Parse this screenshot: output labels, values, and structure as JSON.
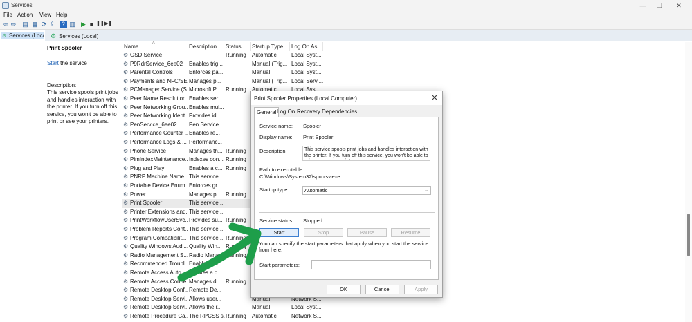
{
  "window": {
    "title": "Services",
    "min_glyph": "—",
    "max_glyph": "❐",
    "close_glyph": "✕"
  },
  "menu": [
    "File",
    "Action",
    "View",
    "Help"
  ],
  "toolbar": {
    "icons": [
      "back-icon",
      "forward-icon",
      "console-tree-icon",
      "properties-icon",
      "refresh-icon",
      "export-icon",
      "help-icon",
      "view-icon",
      "start-service-icon",
      "stop-service-icon",
      "pause-service-icon",
      "restart-service-icon"
    ],
    "glyphs": [
      "⇦",
      "⇨",
      "▤",
      "▦",
      "⟳",
      "⇪",
      "?",
      "▥",
      "▶",
      "■",
      "❚❚",
      "▶❚"
    ]
  },
  "tree": {
    "node": "Services (Loca"
  },
  "header": {
    "title": "Services (Local)"
  },
  "detail": {
    "service_name": "Print Spooler",
    "start_link": "Start",
    "start_suffix": " the service",
    "description_label": "Description:",
    "description": "This service spools print jobs and handles interaction with the printer.  If you turn off this service, you won't be able to print or see your printers."
  },
  "columns": {
    "name": "Name",
    "description": "Description",
    "status": "Status",
    "startup_type": "Startup Type",
    "log_on_as": "Log On As",
    "sort_glyph": "^"
  },
  "services": [
    {
      "name": "OSD Service",
      "desc": "",
      "status": "Running",
      "stype": "Automatic",
      "logon": "Local Syst..."
    },
    {
      "name": "P9RdrService_6ee02",
      "desc": "Enables trig...",
      "status": "",
      "stype": "Manual (Trig...",
      "logon": "Local Syst..."
    },
    {
      "name": "Parental Controls",
      "desc": "Enforces pa...",
      "status": "",
      "stype": "Manual",
      "logon": "Local Syst..."
    },
    {
      "name": "Payments and NFC/SE...",
      "desc": "Manages p...",
      "status": "",
      "stype": "Manual (Trig...",
      "logon": "Local Servi..."
    },
    {
      "name": "PCManager Service (S...",
      "desc": "Microsoft P...",
      "status": "Running",
      "stype": "Automatic",
      "logon": "Local Syst..."
    },
    {
      "name": "Peer Name Resolution...",
      "desc": "Enables ser...",
      "status": "",
      "stype": "",
      "logon": ""
    },
    {
      "name": "Peer Networking Grou...",
      "desc": "Enables mul...",
      "status": "",
      "stype": "",
      "logon": ""
    },
    {
      "name": "Peer Networking Ident...",
      "desc": "Provides id...",
      "status": "",
      "stype": "",
      "logon": ""
    },
    {
      "name": "PenService_6ee02",
      "desc": "Pen Service",
      "status": "",
      "stype": "",
      "logon": ""
    },
    {
      "name": "Performance Counter ...",
      "desc": "Enables re...",
      "status": "",
      "stype": "",
      "logon": ""
    },
    {
      "name": "Performance Logs & ...",
      "desc": "Performanc...",
      "status": "",
      "stype": "",
      "logon": ""
    },
    {
      "name": "Phone Service",
      "desc": "Manages th...",
      "status": "Running",
      "stype": "",
      "logon": ""
    },
    {
      "name": "PimIndexMaintenance...",
      "desc": "Indexes con...",
      "status": "Running",
      "stype": "",
      "logon": ""
    },
    {
      "name": "Plug and Play",
      "desc": "Enables a c...",
      "status": "Running",
      "stype": "",
      "logon": ""
    },
    {
      "name": "PNRP Machine Name ...",
      "desc": "This service ...",
      "status": "",
      "stype": "",
      "logon": ""
    },
    {
      "name": "Portable Device Enum...",
      "desc": "Enforces gr...",
      "status": "",
      "stype": "",
      "logon": ""
    },
    {
      "name": "Power",
      "desc": "Manages p...",
      "status": "Running",
      "stype": "",
      "logon": ""
    },
    {
      "name": "Print Spooler",
      "desc": "This service ...",
      "status": "",
      "stype": "",
      "logon": ""
    },
    {
      "name": "Printer Extensions and...",
      "desc": "This service ...",
      "status": "",
      "stype": "",
      "logon": ""
    },
    {
      "name": "PrintWorkflowUserSvc...",
      "desc": "Provides su...",
      "status": "Running",
      "stype": "",
      "logon": ""
    },
    {
      "name": "Problem Reports Cont...",
      "desc": "This service ...",
      "status": "",
      "stype": "",
      "logon": ""
    },
    {
      "name": "Program Compatibilit...",
      "desc": "This service ...",
      "status": "Running",
      "stype": "",
      "logon": ""
    },
    {
      "name": "Quality Windows Audi...",
      "desc": "Quality Win...",
      "status": "Running",
      "stype": "",
      "logon": ""
    },
    {
      "name": "Radio Management S...",
      "desc": "Radio Mana...",
      "status": "Running",
      "stype": "",
      "logon": ""
    },
    {
      "name": "Recommended Troubl...",
      "desc": "Enables aut...",
      "status": "",
      "stype": "",
      "logon": ""
    },
    {
      "name": "Remote Access Auto...",
      "desc": "Creates a c...",
      "status": "",
      "stype": "",
      "logon": ""
    },
    {
      "name": "Remote Access Conne...",
      "desc": "Manages di...",
      "status": "Running",
      "stype": "",
      "logon": ""
    },
    {
      "name": "Remote Desktop Conf...",
      "desc": "Remote De...",
      "status": "",
      "stype": "",
      "logon": ""
    },
    {
      "name": "Remote Desktop Servi...",
      "desc": "Allows user...",
      "status": "",
      "stype": "Manual",
      "logon": "Network S..."
    },
    {
      "name": "Remote Desktop Servi...",
      "desc": "Allows the r...",
      "status": "",
      "stype": "Manual",
      "logon": "Local Syst..."
    },
    {
      "name": "Remote Procedure Ca...",
      "desc": "The RPCSS s...",
      "status": "Running",
      "stype": "Automatic",
      "logon": "Network S..."
    }
  ],
  "selected_row": 17,
  "dialog": {
    "title": "Print Spooler Properties (Local Computer)",
    "tabs": [
      "General",
      "Log On",
      "Recovery",
      "Dependencies"
    ],
    "service_name_label": "Service name:",
    "service_name": "Spooler",
    "display_name_label": "Display name:",
    "display_name": "Print Spooler",
    "description_label": "Description:",
    "description": "This service spools print jobs and handles interaction with the printer.  If you turn off this service, you won't be able to print or see your printers.",
    "path_label": "Path to executable:",
    "path": "C:\\Windows\\System32\\spoolsv.exe",
    "startup_label": "Startup type:",
    "startup": "Automatic",
    "status_label": "Service status:",
    "status": "Stopped",
    "buttons": {
      "start": "Start",
      "stop": "Stop",
      "pause": "Pause",
      "resume": "Resume"
    },
    "hint": "You can specify the start parameters that apply when you start the service from here.",
    "params_label": "Start parameters:",
    "params": "",
    "ok": "OK",
    "cancel": "Cancel",
    "apply": "Apply"
  },
  "colors": {
    "annotation_arrow": "#1e9e4a",
    "selection": "#cde2f7",
    "accent": "#3d7fd0"
  }
}
